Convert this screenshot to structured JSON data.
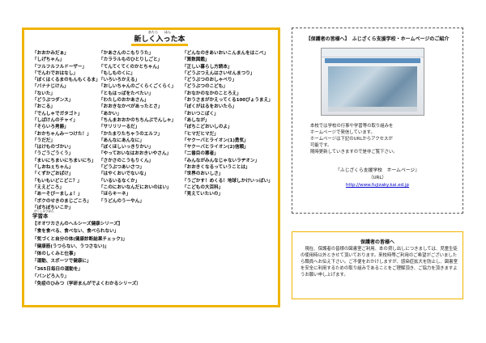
{
  "books": {
    "ruby": "あたら　　ほん",
    "title": "新しく入った本",
    "column1": [
      "「おおかみだぁ」",
      "「しげちゃん」",
      "「フルフルフルドーザー」",
      "「でんわでおはなし」",
      "「ぼくはくるまのもんもくるま」",
      "「バナナじけん」",
      "「ないた」",
      "「どうぶつダンス」",
      "「おこる」",
      "「でんしゃでガタゴト」",
      "「しばけんのチャイ」",
      "「そらいろ男爵」",
      "「おかちゃんみーつけた！」",
      "「うだだ」",
      "「はけものづかい」",
      "「うごうごうくう」",
      "「まいにちまいにちまいにち」",
      "「しおねぇちゃん」",
      "「くずかごおばけ」",
      "「もいもいどこどこ？」",
      "「ええどころ」",
      "「あーそびーましょ！」",
      "「ボクのせきのまじごころ」",
      "「ぼちぼちいこか」"
    ],
    "column2": [
      "「かあさんのこもりうた」",
      "「カララルものひとりしごと」",
      "「てんてくてくのかとちゃん」",
      "「もしものくに」",
      "「いろいろかえる」",
      "「おしいちゃんのごくらくごくらく」",
      "「ともはっぱをたべたい」",
      "「わたしのおかあさん」",
      "「おおきなかべがあったとさ」",
      "「あかい」",
      "「ちんまおおかのちちんぷでんしゃ」",
      "「サリリリーるだ」",
      "「かたまりたちゃうのエルフ」",
      "「あんなにあんなに」",
      "「ぼくほしいっきりかい」",
      "「やっておいなはおおきいやさん」",
      "「さかさのこうもりくん」",
      "「どうぶつあいさつ」",
      "「はやくおいでないな」",
      "「いるいるなくか」",
      "「このにおいなんだにおいのはい」",
      "「ほらキーネ」",
      "「うどんのうーやん」"
    ],
    "column3": [
      "「どんなのきあいおいこんまんをはこべ」",
      "「算数図鑑」",
      "「正しい暮らし方読本」",
      "「どうぶつえんはさいせんまつり」",
      "「どうぶつのおしゃべり」",
      "「どうぶつのこども」",
      "「おなかのなかのことろえ」",
      "「おうさまがかえってくる100びょうまえ」",
      "「ぼくがはるをおいたら」",
      "「おいつこばく」",
      "「あしなが」",
      "「ぼちこどおいしのよ」",
      "「ヒマだヒマだ」",
      "「ヤクーバとライオン(1)勇気」",
      "「ヤクーバとライオン(2)信頼」",
      "「二番目の悪者」",
      "「みんながみんなじゃないラヂオン」",
      "「おおきくなるっていうことは」",
      "「世界のおいしさ」",
      "「うごかす！めくる！地球しかけいっぱい」",
      "「こどもの大百科」",
      "「見えていたいの」"
    ],
    "sub": {
      "ruby": "がくしゅうぼん",
      "title": "学習本",
      "items": [
        "【オオワカさんのヘルシーズ健康シリーズ】",
        "「食を食べる、食べない、食べられない」",
        "「気づくと自分の体(健康診断結果チェック)」",
        "「健康筋(うつらない、うつさない)」",
        "「体のしくみと仕事」",
        "「運動、スポーツで健康に」",
        "「365日毎日の運動を」",
        "「バンどろ入り」",
        "「免疫のひみつ（学研まんがでよくわかるシリーズ）"
      ]
    }
  },
  "notice": {
    "title": "【保護者の皆様へ】　ふじざくら支援学校・ホームページのご紹介",
    "body": [
      "本校では学校の行事や学習等の取り組みを",
      "ホームページで発信しています。",
      "ホームページは下記のURLからアクセスが",
      "可能です。",
      "随時更新していきますので是非ご覧下さい。"
    ],
    "site_name": "『ふじざくら支援学校　ホームページ』",
    "url_label": "（URL）",
    "url": "http://www.fujizaky.kai.ed.jp"
  },
  "guardians": {
    "title": "保護者の皆様へ",
    "body": "　現在、保護者の皆様の図書室ご利用、本の貸し出しにつきましては、児童生徒の使用時以外ときせて頂いております。来校時等ご利用のご希望がございましたら職員へお伝え下さい。ご不便をおかけしますが、感染症拡大を防止し、図書室を安全に利用するための取り組みであることをご理解頂き、ご協力を頂きますようお願い申し上げます。"
  }
}
